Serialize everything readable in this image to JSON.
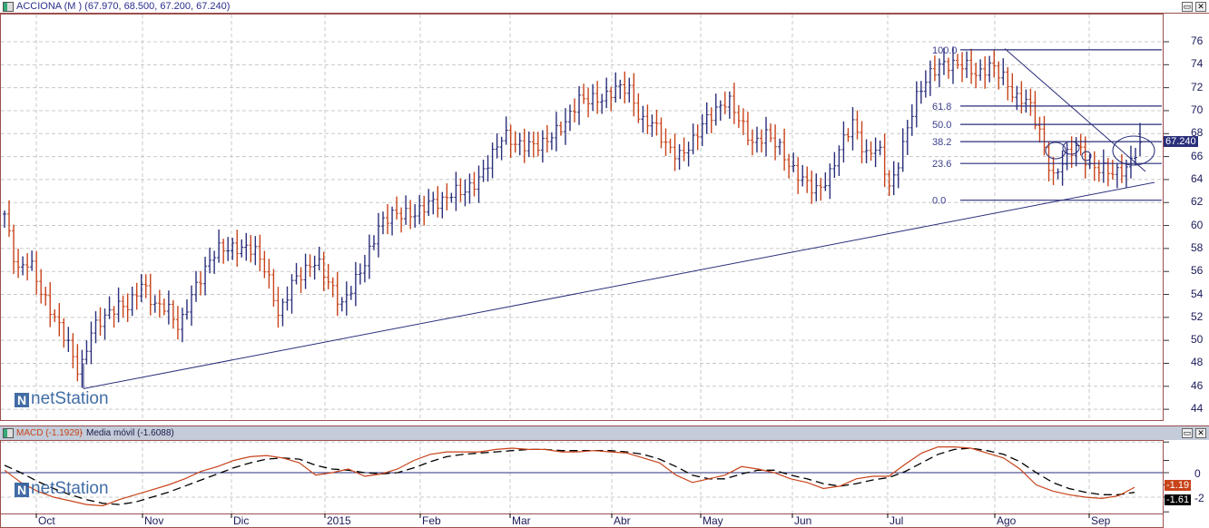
{
  "window": {
    "title": "ACCIONA (M ) (67.970, 68.500, 67.200, 67.240)",
    "restore_icon": "restore-icon",
    "close_icon": "close-icon"
  },
  "logo_text": "netStation",
  "chart_data": [
    {
      "type": "ohlc",
      "title": "ACCIONA (M )",
      "last_ohlc": {
        "open": 67.97,
        "high": 68.5,
        "low": 67.2,
        "close": 67.24
      },
      "last_price_label": "67.240",
      "y_ticks": [
        76,
        74,
        72,
        70,
        68,
        66,
        64,
        62,
        60,
        58,
        56,
        54,
        52,
        50,
        48,
        46,
        44
      ],
      "ylim": [
        43.5,
        77
      ],
      "x_labels": [
        "Oct",
        "Nov",
        "Dic",
        "2015",
        "Feb",
        "Mar",
        "Abr",
        "May",
        "Jun",
        "Jul",
        "Ago",
        "Sep"
      ],
      "close_samples": [
        61,
        56,
        57,
        54,
        52,
        50,
        47,
        51,
        52,
        53,
        53,
        55,
        53,
        53,
        51,
        54,
        56,
        58,
        58,
        58,
        58,
        56,
        52,
        55,
        56,
        57,
        55,
        53,
        55,
        57,
        60,
        61,
        61,
        61,
        62,
        62,
        63,
        63,
        64,
        66,
        68,
        67,
        67,
        67,
        68,
        69,
        71,
        71,
        71,
        72,
        72,
        69,
        69,
        67,
        66,
        67,
        69,
        70,
        71,
        69,
        67,
        68,
        67,
        65,
        64,
        63,
        64,
        67,
        69,
        66,
        67,
        63,
        67,
        71,
        73,
        74,
        74,
        74,
        73,
        74,
        73,
        71,
        71,
        68,
        64,
        66,
        67,
        65,
        65,
        64.5,
        65,
        67.24
      ],
      "colors": {
        "up": "#2a2f7a",
        "down": "#c8431a"
      },
      "trendlines": [
        {
          "name": "support",
          "from": 45.8,
          "to": 63.75
        },
        {
          "name": "resistance",
          "from": 75.4,
          "to": 64.7
        }
      ],
      "fibonacci": [
        {
          "label": "100.0",
          "value": 75.3
        },
        {
          "label": "61.8",
          "value": 70.4
        },
        {
          "label": "50.0",
          "value": 68.8
        },
        {
          "label": "38.2",
          "value": 67.3
        },
        {
          "label": "23.6",
          "value": 65.4
        },
        {
          "label": "0.0",
          "value": 62.2
        }
      ]
    },
    {
      "type": "line",
      "title_macd": "MACD (-1.1929)",
      "title_signal": "Media móvil (-1.6088)",
      "y_ticks": [
        "0",
        "-2"
      ],
      "ylim": [
        -3.5,
        2.5
      ],
      "macd": [
        0.2,
        -0.8,
        -1.5,
        -2.0,
        -2.3,
        -2.6,
        -2.7,
        -2.2,
        -1.8,
        -1.4,
        -1.0,
        -0.5,
        0.1,
        0.5,
        1.0,
        1.3,
        1.4,
        1.2,
        0.8,
        -0.2,
        0.0,
        0.3,
        -0.3,
        -0.1,
        0.3,
        1.0,
        1.5,
        1.7,
        1.7,
        1.7,
        1.9,
        2.0,
        1.9,
        1.9,
        1.7,
        1.7,
        1.8,
        1.7,
        1.6,
        1.2,
        0.8,
        -0.2,
        -0.8,
        -0.5,
        -0.2,
        0.5,
        0.3,
        0.0,
        -0.5,
        -0.8,
        -1.3,
        -1.1,
        -0.5,
        -0.3,
        -0.3,
        0.7,
        1.6,
        2.1,
        2.1,
        2.0,
        1.6,
        1.2,
        0.3,
        -1.0,
        -1.5,
        -1.8,
        -2.0,
        -2.1,
        -1.9,
        -1.19
      ],
      "signal": [
        0.6,
        0.0,
        -0.7,
        -1.3,
        -1.8,
        -2.2,
        -2.5,
        -2.6,
        -2.4,
        -2.0,
        -1.6,
        -1.1,
        -0.6,
        -0.1,
        0.4,
        0.8,
        1.1,
        1.2,
        1.1,
        0.6,
        0.3,
        0.2,
        0.0,
        -0.1,
        0.0,
        0.4,
        0.9,
        1.3,
        1.5,
        1.6,
        1.7,
        1.8,
        1.9,
        1.9,
        1.8,
        1.8,
        1.8,
        1.8,
        1.7,
        1.5,
        1.1,
        0.5,
        -0.2,
        -0.5,
        -0.5,
        -0.1,
        0.2,
        0.2,
        -0.2,
        -0.5,
        -0.9,
        -1.1,
        -0.9,
        -0.6,
        -0.4,
        0.1,
        0.8,
        1.5,
        1.9,
        2.0,
        1.8,
        1.5,
        0.9,
        0.0,
        -0.8,
        -1.3,
        -1.6,
        -1.8,
        -1.8,
        -1.61
      ],
      "macd_label": "-1.19",
      "signal_label": "-1.61",
      "colors": {
        "macd": "#c8431a",
        "signal": "#000000",
        "zero": "#2a2f7a"
      }
    }
  ]
}
